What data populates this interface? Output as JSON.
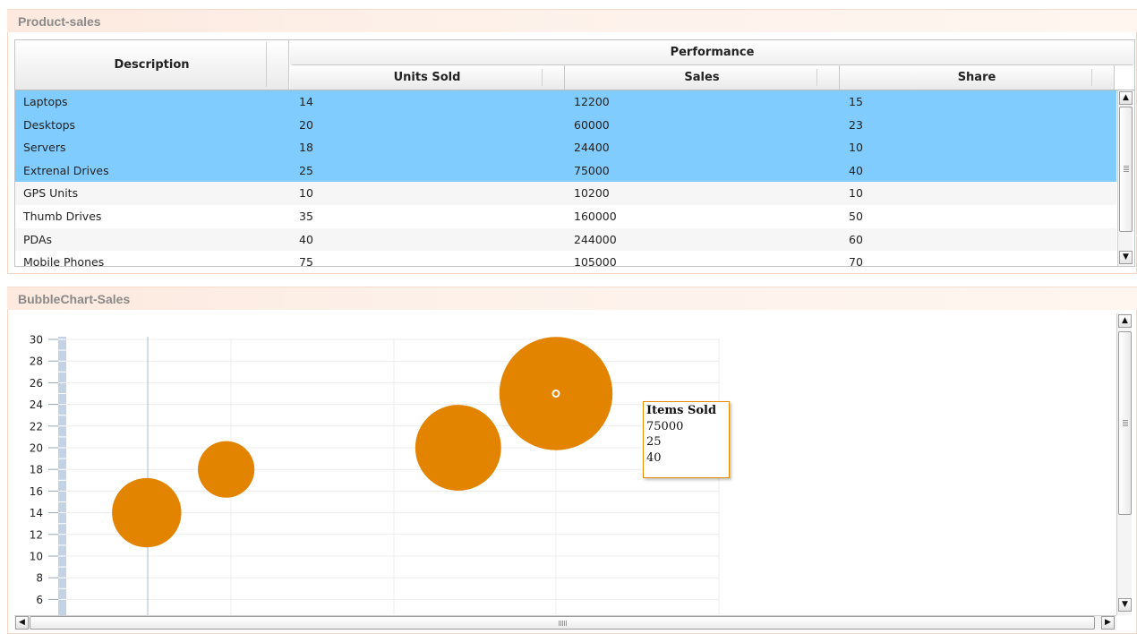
{
  "panel1": {
    "title": "Product-sales"
  },
  "table": {
    "col_description": "Description",
    "group_performance": "Performance",
    "col_units": "Units Sold",
    "col_sales": "Sales",
    "col_share": "Share",
    "rows": [
      {
        "description": "Laptops",
        "units": "14",
        "sales": "12200",
        "share": "15",
        "selected": true
      },
      {
        "description": "Desktops",
        "units": "20",
        "sales": "60000",
        "share": "23",
        "selected": true
      },
      {
        "description": "Servers",
        "units": "18",
        "sales": "24400",
        "share": "10",
        "selected": true
      },
      {
        "description": "Extrenal Drives",
        "units": "25",
        "sales": "75000",
        "share": "40",
        "selected": true
      },
      {
        "description": "GPS Units",
        "units": "10",
        "sales": "10200",
        "share": "10",
        "selected": false
      },
      {
        "description": "Thumb Drives",
        "units": "35",
        "sales": "160000",
        "share": "50",
        "selected": false
      },
      {
        "description": "PDAs",
        "units": "40",
        "sales": "244000",
        "share": "60",
        "selected": false
      },
      {
        "description": "Mobile Phones",
        "units": "75",
        "sales": "105000",
        "share": "70",
        "selected": false
      }
    ]
  },
  "panel2": {
    "title": "BubbleChart-Sales"
  },
  "chart_data": {
    "type": "scatter",
    "bubble": true,
    "title": "",
    "xlabel": "",
    "ylabel": "",
    "yticks": [
      "30",
      "28",
      "26",
      "24",
      "22",
      "20",
      "18",
      "16",
      "14",
      "12",
      "10",
      "8",
      "6"
    ],
    "ylim_visible": [
      5,
      30
    ],
    "points": [
      {
        "label": "Laptops",
        "sales": 12200,
        "units": 14,
        "share": 15
      },
      {
        "label": "Desktops",
        "sales": 60000,
        "units": 20,
        "share": 23
      },
      {
        "label": "Servers",
        "sales": 24400,
        "units": 18,
        "share": 10
      },
      {
        "label": "Extrenal Drives",
        "sales": 75000,
        "units": 25,
        "share": 40
      }
    ],
    "bubble_color": "#e28400",
    "grid": true
  },
  "tooltip": {
    "title": "Items Sold",
    "line1": "75000",
    "line2": "25",
    "line3": "40"
  },
  "scroll": {
    "up": "▲",
    "down": "▼",
    "left": "◀",
    "right": "▶"
  }
}
